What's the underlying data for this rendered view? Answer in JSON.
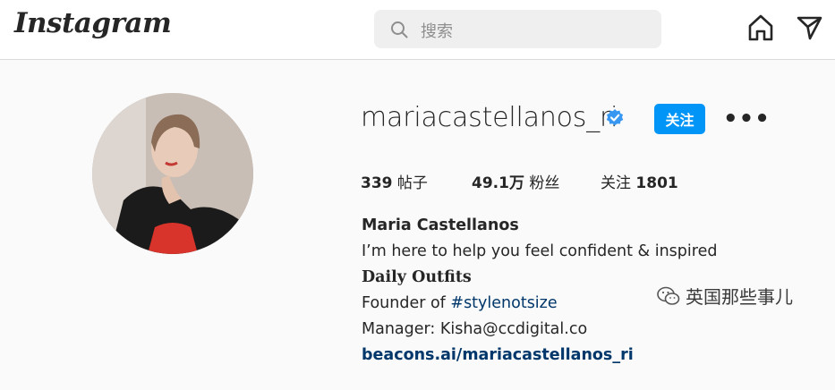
{
  "header": {
    "logo_text": "Instagram",
    "search_placeholder": "搜索",
    "icons": [
      "home-icon",
      "direct-icon"
    ]
  },
  "profile": {
    "username": "mariacastellanos_ri",
    "verified": true,
    "follow_label": "关注",
    "more_label": "•••",
    "stats": {
      "posts_count": "339",
      "posts_label": "帖子",
      "followers_count": "49.1万",
      "followers_label": "粉丝",
      "following_label": "关注",
      "following_count": "1801"
    },
    "bio": {
      "full_name": "Maria Castellanos",
      "line1": "I’m here to help you feel confident & inspired",
      "line2": "Daily Outfits",
      "line3_prefix": "Founder of ",
      "line3_tag": "#stylenotsize",
      "line4": "Manager: Kisha@ccdigital.co",
      "website": "beacons.ai/mariacastellanos_ri"
    }
  },
  "watermark": {
    "text": "英国那些事儿"
  },
  "colors": {
    "accent": "#0095f6",
    "link": "#00376b",
    "verified_badge": "#3897f0",
    "background": "#fafafa"
  }
}
